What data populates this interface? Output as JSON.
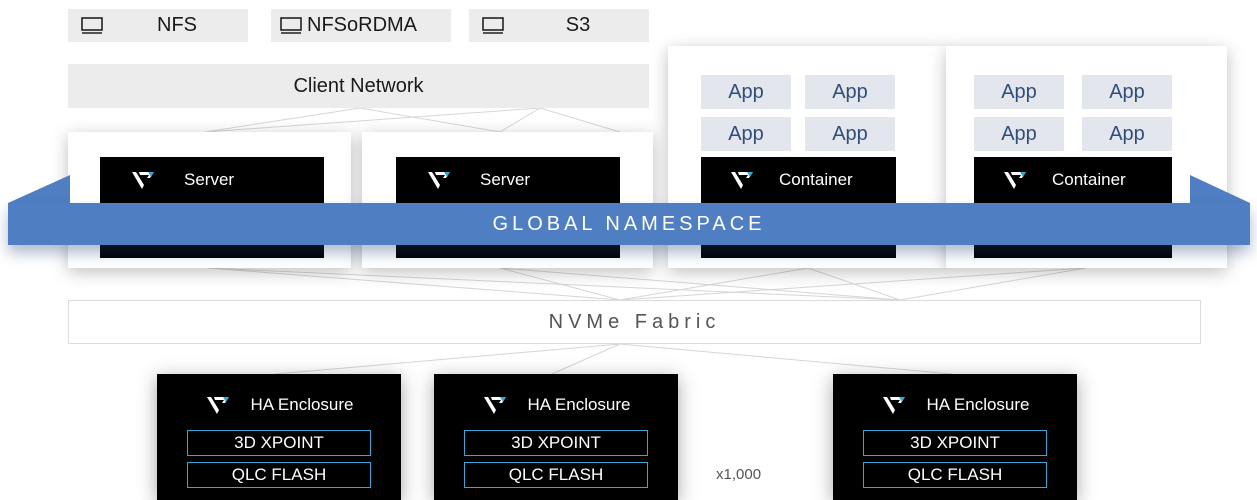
{
  "protocols": [
    {
      "label": "NFS",
      "icon": "monitor-icon"
    },
    {
      "label": "NFSoRDMA",
      "icon": "monitor-icon"
    },
    {
      "label": "S3",
      "icon": "monitor-icon"
    }
  ],
  "client_network": "Client Network",
  "hosts": [
    {
      "label": "Server",
      "icon": "weka-logo-icon"
    },
    {
      "label": "Server",
      "icon": "weka-logo-icon"
    },
    {
      "label": "Container",
      "icon": "weka-logo-icon",
      "apps": [
        "App",
        "App",
        "App",
        "App"
      ]
    },
    {
      "label": "Container",
      "icon": "weka-logo-icon",
      "apps": [
        "App",
        "App",
        "App",
        "App"
      ]
    }
  ],
  "namespace": "GLOBAL NAMESPACE",
  "fabric": "NVMe Fabric",
  "enclosures": [
    {
      "label": "HA Enclosure",
      "tiers": [
        "3D XPOINT",
        "QLC FLASH"
      ]
    },
    {
      "label": "HA Enclosure",
      "tiers": [
        "3D XPOINT",
        "QLC FLASH"
      ]
    },
    {
      "label": "HA Enclosure",
      "tiers": [
        "3D XPOINT",
        "QLC FLASH"
      ]
    }
  ],
  "multiplier": "x1,000",
  "colors": {
    "namespace": "#4f7fc2",
    "tier_border": "#3aa6d8",
    "app_text": "#2f4f7a"
  }
}
